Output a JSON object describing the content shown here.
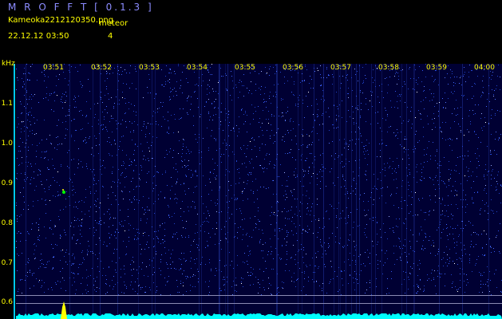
{
  "header": {
    "app_title": "M R O F F T [ 0.1.3 ]",
    "file_name": "Kameoka2212120350.png",
    "meteor_label": "meteor",
    "date_time": "22.12.12 03:50",
    "meteor_count": "4"
  },
  "spectrogram": {
    "y_unit": "kHz",
    "y_ticks": [
      "1.1",
      "1.0",
      "0.9",
      "0.8",
      "0.7",
      "0.6"
    ],
    "x_ticks": [
      "03:51",
      "03:52",
      "03:53",
      "03:54",
      "03:55",
      "03:56",
      "03:57",
      "03:58",
      "03:59",
      "04:00"
    ],
    "colors": {
      "background": "#000033",
      "noise": "#3366ff",
      "signal": "#00ffff",
      "meteor": "#ffff00",
      "labels": "#ffff00",
      "title": "#8c8cff"
    }
  }
}
